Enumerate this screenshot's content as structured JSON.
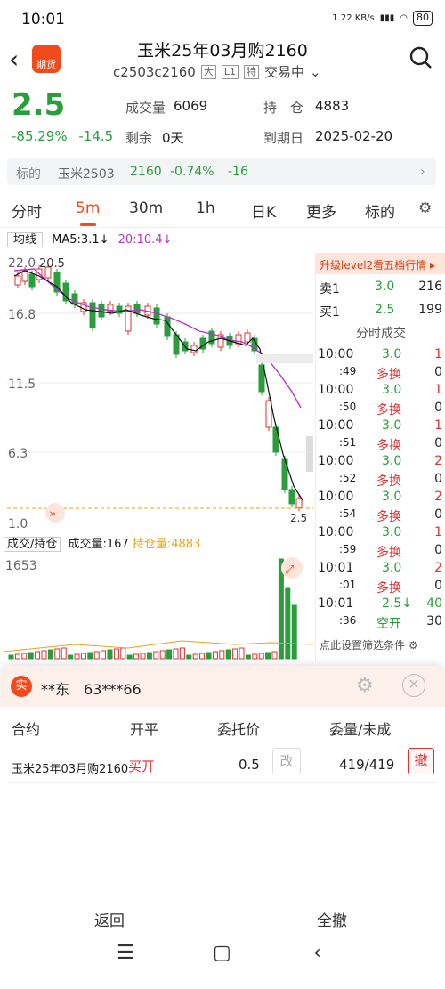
{
  "status": {
    "time": "10:01",
    "speed": "1.22 KB/s",
    "battery": "80"
  },
  "header": {
    "title": "玉米25年03月购2160",
    "code": "c2503c2160",
    "tag_big": "大",
    "tag_l1": "L1",
    "tag_te": "特",
    "trade_state": "交易中",
    "logo_text": "期货"
  },
  "quote": {
    "price": "2.5",
    "pct": "-85.29%",
    "chg": "-14.5",
    "vol_label": "成交量",
    "vol": "6069",
    "oi_label": "持　仓",
    "oi": "4883",
    "remain_label": "剩余",
    "remain": "0天",
    "expire_label": "到期日",
    "expire": "2025-02-20"
  },
  "underlying": {
    "label": "标的",
    "name": "玉米2503",
    "price": "2160",
    "pct": "-0.74%",
    "chg": "-16"
  },
  "tabs": [
    "分时",
    "5m",
    "30m",
    "1h",
    "日K",
    "更多",
    "标的"
  ],
  "chart": {
    "ma_select": "均线",
    "ma5": "MA5:3.1↓",
    "ma20": "20:10.4↓",
    "y_ticks": [
      "22.0",
      "16.8",
      "11.5",
      "6.3",
      "1.0"
    ],
    "high_label": "20.5",
    "last_label": "2.5",
    "vol_select": "成交/持仓",
    "vol_text": "成交量:167",
    "oi_text": "持仓量:4883",
    "vol_max": "1653"
  },
  "panel": {
    "banner": "升级level2看五档行情 ▸",
    "ask_label": "卖1",
    "ask_price": "3.0",
    "ask_qty": "216",
    "bid_label": "买1",
    "bid_price": "2.5",
    "bid_qty": "199",
    "ticks_title": "分时成交",
    "ticks": [
      {
        "t": "10:00",
        "p": "3.0",
        "q": "1",
        "s": ":49",
        "k": "多换",
        "n": "0"
      },
      {
        "t": "10:00",
        "p": "3.0",
        "q": "1",
        "s": ":50",
        "k": "多换",
        "n": "0"
      },
      {
        "t": "10:00",
        "p": "3.0",
        "q": "1",
        "s": ":51",
        "k": "多换",
        "n": "0"
      },
      {
        "t": "10:00",
        "p": "3.0",
        "q": "2",
        "s": ":52",
        "k": "多换",
        "n": "0"
      },
      {
        "t": "10:00",
        "p": "3.0",
        "q": "2",
        "s": ":54",
        "k": "多换",
        "n": "0"
      },
      {
        "t": "10:00",
        "p": "3.0",
        "q": "1",
        "s": ":59",
        "k": "多换",
        "n": "0"
      },
      {
        "t": "10:01",
        "p": "3.0",
        "q": "2",
        "s": ":01",
        "k": "多换",
        "n": "0"
      },
      {
        "t": "10:01",
        "p": "2.5↓",
        "q": "40",
        "s": ":36",
        "k": "空开",
        "n": "30"
      }
    ],
    "filter": "点此设置筛选条件"
  },
  "sheet": {
    "badge": "实",
    "account": "**东　63***66",
    "headers": [
      "合约",
      "开平",
      "委托价",
      "委量/未成"
    ],
    "row": {
      "contract": "玉米25年03月购2160",
      "side": "买开",
      "price": "0.5",
      "amend": "改",
      "qty": "419/419",
      "cancel": "撤"
    },
    "back": "返回",
    "cancel_all": "全撤"
  }
}
